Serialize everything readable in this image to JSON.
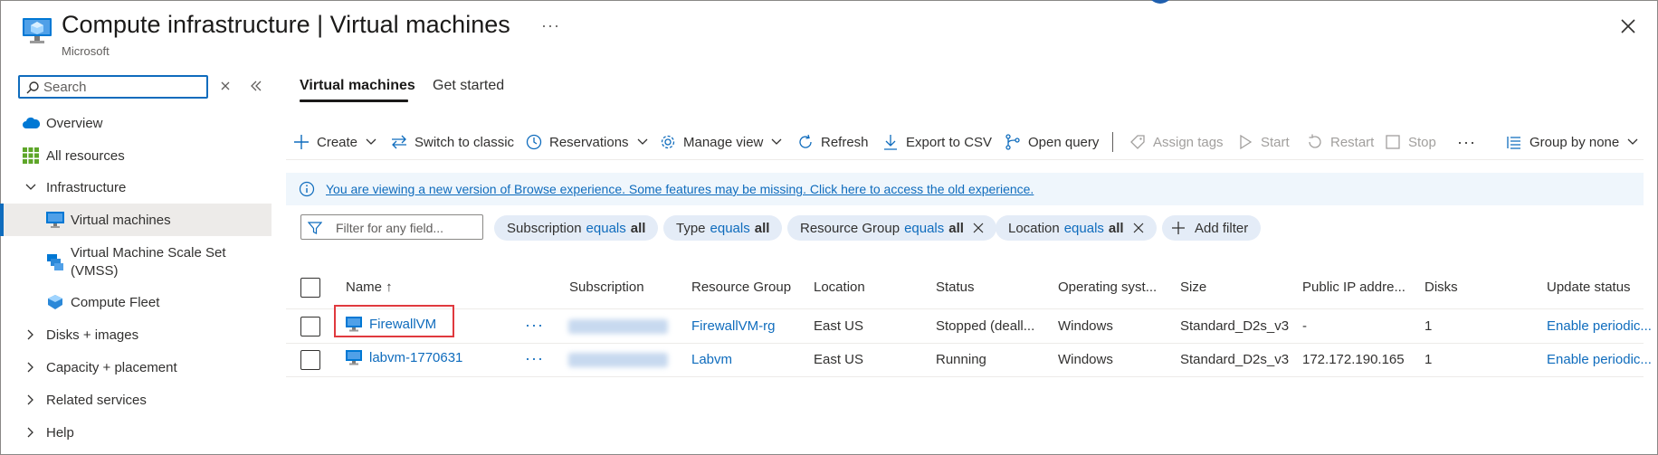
{
  "header": {
    "title": "Compute infrastructure | Virtual machines",
    "subtitle": "Microsoft",
    "more_label": "···"
  },
  "sidebar": {
    "search_placeholder": "Search",
    "items": [
      {
        "label": "Overview"
      },
      {
        "label": "All resources"
      },
      {
        "label": "Infrastructure"
      },
      {
        "label": "Virtual machines"
      },
      {
        "label": "Virtual Machine Scale Set (VMSS)"
      },
      {
        "label": "Compute Fleet"
      },
      {
        "label": "Disks + images"
      },
      {
        "label": "Capacity + placement"
      },
      {
        "label": "Related services"
      },
      {
        "label": "Help"
      }
    ]
  },
  "tabs": [
    {
      "label": "Virtual machines"
    },
    {
      "label": "Get started"
    }
  ],
  "toolbar": {
    "create": "Create",
    "switch_classic": "Switch to classic",
    "reservations": "Reservations",
    "manage_view": "Manage view",
    "refresh": "Refresh",
    "export_csv": "Export to CSV",
    "open_query": "Open query",
    "assign_tags": "Assign tags",
    "start": "Start",
    "restart": "Restart",
    "stop": "Stop",
    "more": "···",
    "group_by": "Group by none"
  },
  "banner": {
    "text": "You are viewing a new version of Browse experience. Some features may be missing. Click here to access the old experience."
  },
  "filters": {
    "placeholder": "Filter for any field...",
    "pills": [
      {
        "field": "Subscription",
        "op": "equals",
        "value": "all"
      },
      {
        "field": "Type",
        "op": "equals",
        "value": "all"
      },
      {
        "field": "Resource Group",
        "op": "equals",
        "value": "all"
      },
      {
        "field": "Location",
        "op": "equals",
        "value": "all"
      }
    ],
    "add_filter": "Add filter"
  },
  "grid": {
    "columns": [
      "Name ↑",
      "Subscription",
      "Resource Group",
      "Location",
      "Status",
      "Operating syst...",
      "Size",
      "Public IP addre...",
      "Disks",
      "Update status"
    ],
    "rows": [
      {
        "name": "FirewallVM",
        "resource_group": "FirewallVM-rg",
        "location": "East US",
        "status": "Stopped (deall...",
        "os": "Windows",
        "size": "Standard_D2s_v3",
        "public_ip": "-",
        "disks": "1",
        "update_status": "Enable periodic..."
      },
      {
        "name": "labvm-1770631",
        "resource_group": "Labvm",
        "location": "East US",
        "status": "Running",
        "os": "Windows",
        "size": "Standard_D2s_v3",
        "public_ip": "172.172.190.165",
        "disks": "1",
        "update_status": "Enable periodic..."
      }
    ],
    "row_more": "···"
  },
  "colors": {
    "accent": "#0f6cbd",
    "highlight": "#e0393e",
    "banner_bg": "#eff6fc",
    "pill_bg": "#e4ecf7"
  }
}
